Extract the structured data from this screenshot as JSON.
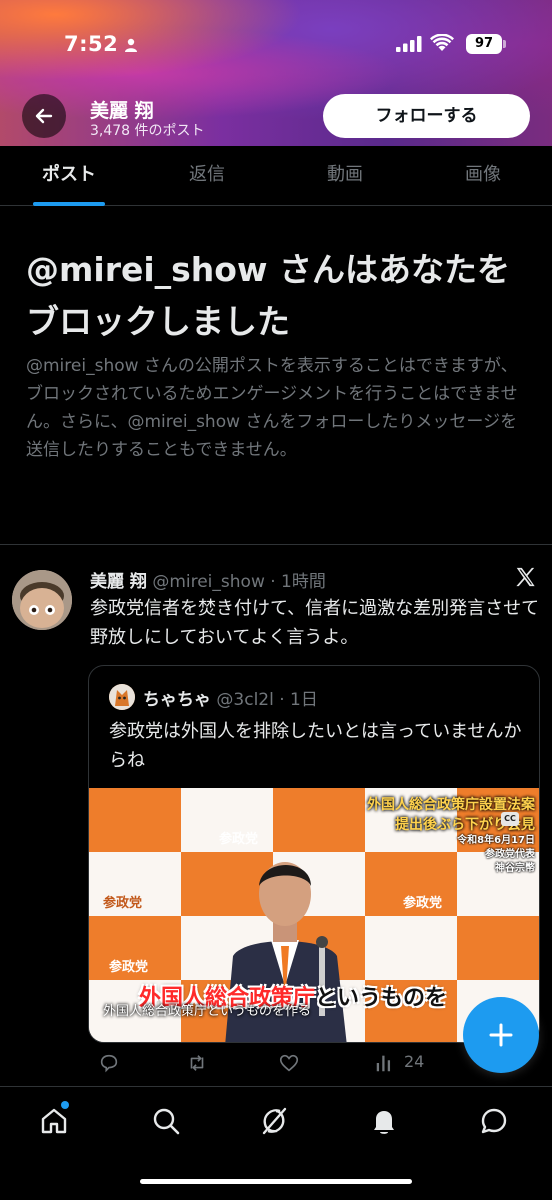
{
  "status_bar": {
    "time": "7:52",
    "battery": "97"
  },
  "profile": {
    "name": "美麗 翔",
    "post_count": "3,478 件のポスト",
    "follow_label": "フォローする"
  },
  "tabs": [
    {
      "label": "ポスト",
      "active": true
    },
    {
      "label": "返信",
      "active": false
    },
    {
      "label": "動画",
      "active": false
    },
    {
      "label": "画像",
      "active": false
    }
  ],
  "blocked": {
    "title": "@mirei_show さんはあなたをブロックしました",
    "description": "@mirei_show さんの公開ポストを表示することはできますが、ブロックされているためエンゲージメントを行うことはできません。さらに、@mirei_show さんをフォローしたりメッセージを送信したりすることもできません。"
  },
  "tweet": {
    "name": "美麗 翔",
    "handle_time": "@mirei_show · 1時間",
    "text": "参政党信者を焚き付けて、信者に過激な差別発言させて野放しにしておいてよく言うよ。",
    "quote": {
      "name": "ちゃちゃ",
      "handle_time": "@3cl2l · 1日",
      "text": "参政党は外国人を排除したいとは言っていませんからね",
      "video": {
        "caption_line1": "外国人総合政策庁設置法案",
        "caption_line2": "提出後ぶら下がり会見",
        "caption_date": "令和8年6月17日",
        "caption_role": "参政党代表",
        "caption_person": "神谷宗幣",
        "cc_label": "CC",
        "backdrop_label": "参政党",
        "subtitle_big_red": "外国人総合政策庁",
        "subtitle_big_rest": "というものを",
        "subtitle_small": "外国人総合政策庁というものを作る"
      }
    },
    "views": "24"
  },
  "colors": {
    "accent": "#1d9bf0",
    "background": "#000000",
    "muted": "#71767b"
  },
  "icons": [
    "back-arrow-icon",
    "x-logo-icon",
    "reply-icon",
    "repost-icon",
    "like-icon",
    "views-icon",
    "compose-plus-icon",
    "home-icon",
    "search-icon",
    "grok-icon",
    "notifications-icon",
    "messages-icon"
  ]
}
